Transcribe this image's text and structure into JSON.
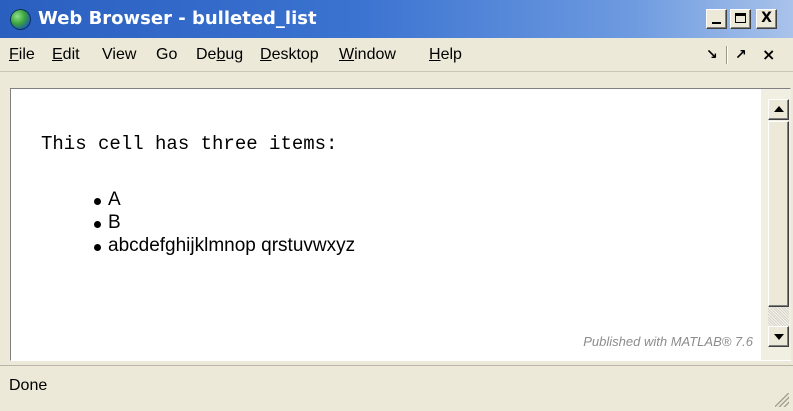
{
  "window": {
    "title": "Web Browser - bulleted_list",
    "icon": "globe-icon",
    "controls": [
      "minimize-icon",
      "maximize-icon",
      "close-icon"
    ],
    "close_glyph": "X"
  },
  "menubar": {
    "items": [
      {
        "label": "File",
        "mnemonic": "F"
      },
      {
        "label": "Edit",
        "mnemonic": "E"
      },
      {
        "label": "View"
      },
      {
        "label": "Go"
      },
      {
        "label": "Debug",
        "mnemonic": "b"
      },
      {
        "label": "Desktop",
        "mnemonic": "D"
      },
      {
        "label": "Window",
        "mnemonic": "W"
      },
      {
        "label": "Help",
        "mnemonic": "H"
      }
    ],
    "dock_glyph": "↘",
    "undock_glyph": "↗",
    "close_glyph": "×"
  },
  "content": {
    "intro": "This cell has three items:",
    "bullets": [
      "A",
      "B",
      "abcdefghijklmnop qrstuvwxyz"
    ],
    "footer": "Published with MATLAB® 7.6"
  },
  "statusbar": {
    "text": "Done"
  }
}
